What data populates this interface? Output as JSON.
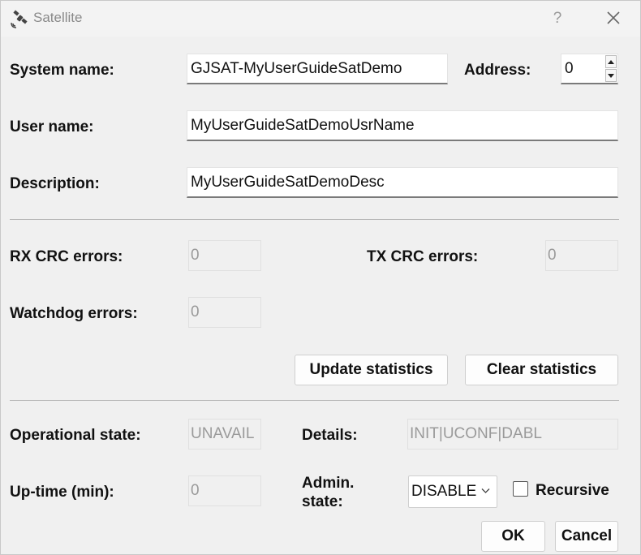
{
  "window": {
    "title": "Satellite",
    "help_label": "?",
    "icons": {
      "app": "satellite-icon",
      "close": "close-icon"
    }
  },
  "form": {
    "system_name_label": "System name:",
    "system_name_value": "GJSAT-MyUserGuideSatDemo",
    "address_label": "Address:",
    "address_value": "0",
    "user_name_label": "User name:",
    "user_name_value": "MyUserGuideSatDemoUsrName",
    "description_label": "Description:",
    "description_value": "MyUserGuideSatDemoDesc"
  },
  "stats": {
    "rx_crc_label": "RX CRC errors:",
    "rx_crc_value": "0",
    "tx_crc_label": "TX CRC errors:",
    "tx_crc_value": "0",
    "watchdog_label": "Watchdog errors:",
    "watchdog_value": "0",
    "update_button": "Update statistics",
    "clear_button": "Clear statistics"
  },
  "state": {
    "operational_label": "Operational state:",
    "operational_value": "UNAVAIL",
    "details_label": "Details:",
    "details_value": "INIT|UCONF|DABL",
    "uptime_label": "Up-time (min):",
    "uptime_value": "0",
    "admin_label_line1": "Admin.",
    "admin_label_line2": "state:",
    "admin_selected": "DISABLE",
    "recursive_label": "Recursive",
    "recursive_checked": false
  },
  "footer": {
    "ok_button": "OK",
    "cancel_button": "Cancel"
  }
}
